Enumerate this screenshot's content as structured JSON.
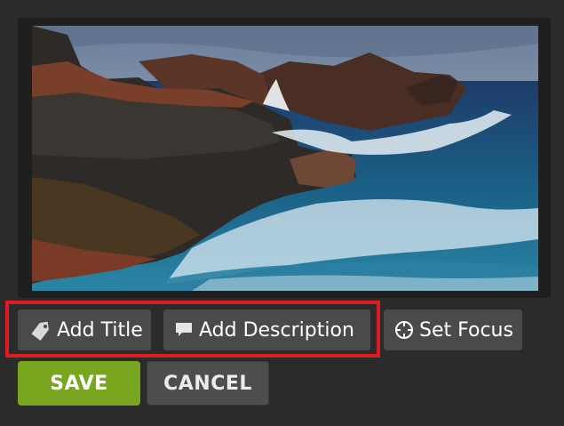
{
  "toolbar": {
    "add_title": "Add Title",
    "add_description": "Add Description",
    "set_focus": "Set Focus"
  },
  "actions": {
    "save": "SAVE",
    "cancel": "CANCEL"
  },
  "icons": {
    "add_title": "tag-icon",
    "add_description": "speech-bubble-icon",
    "set_focus": "crosshair-icon"
  },
  "colors": {
    "background": "#2b2b2b",
    "button_bg": "#4a4a4a",
    "save_green": "#78a61e",
    "highlight_red": "#e01b22"
  }
}
